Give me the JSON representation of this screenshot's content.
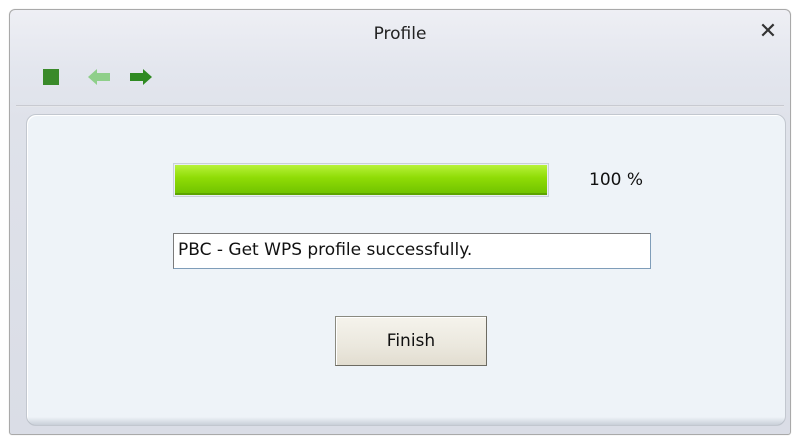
{
  "window": {
    "title": "Profile",
    "close_label": "✕"
  },
  "toolbar": {
    "buttons": [
      {
        "icon": "stop-icon",
        "color": "#3a8a2a"
      },
      {
        "icon": "back-arrow-icon",
        "color": "#8fcf8a",
        "enabled": false
      },
      {
        "icon": "forward-arrow-icon",
        "color": "#2f8a22",
        "enabled": true
      }
    ]
  },
  "progress": {
    "value": 1.0,
    "label": "100 %",
    "fill_color": "#8fdc06"
  },
  "status": {
    "value": "PBC - Get WPS profile successfully."
  },
  "actions": {
    "finish_label": "Finish"
  }
}
